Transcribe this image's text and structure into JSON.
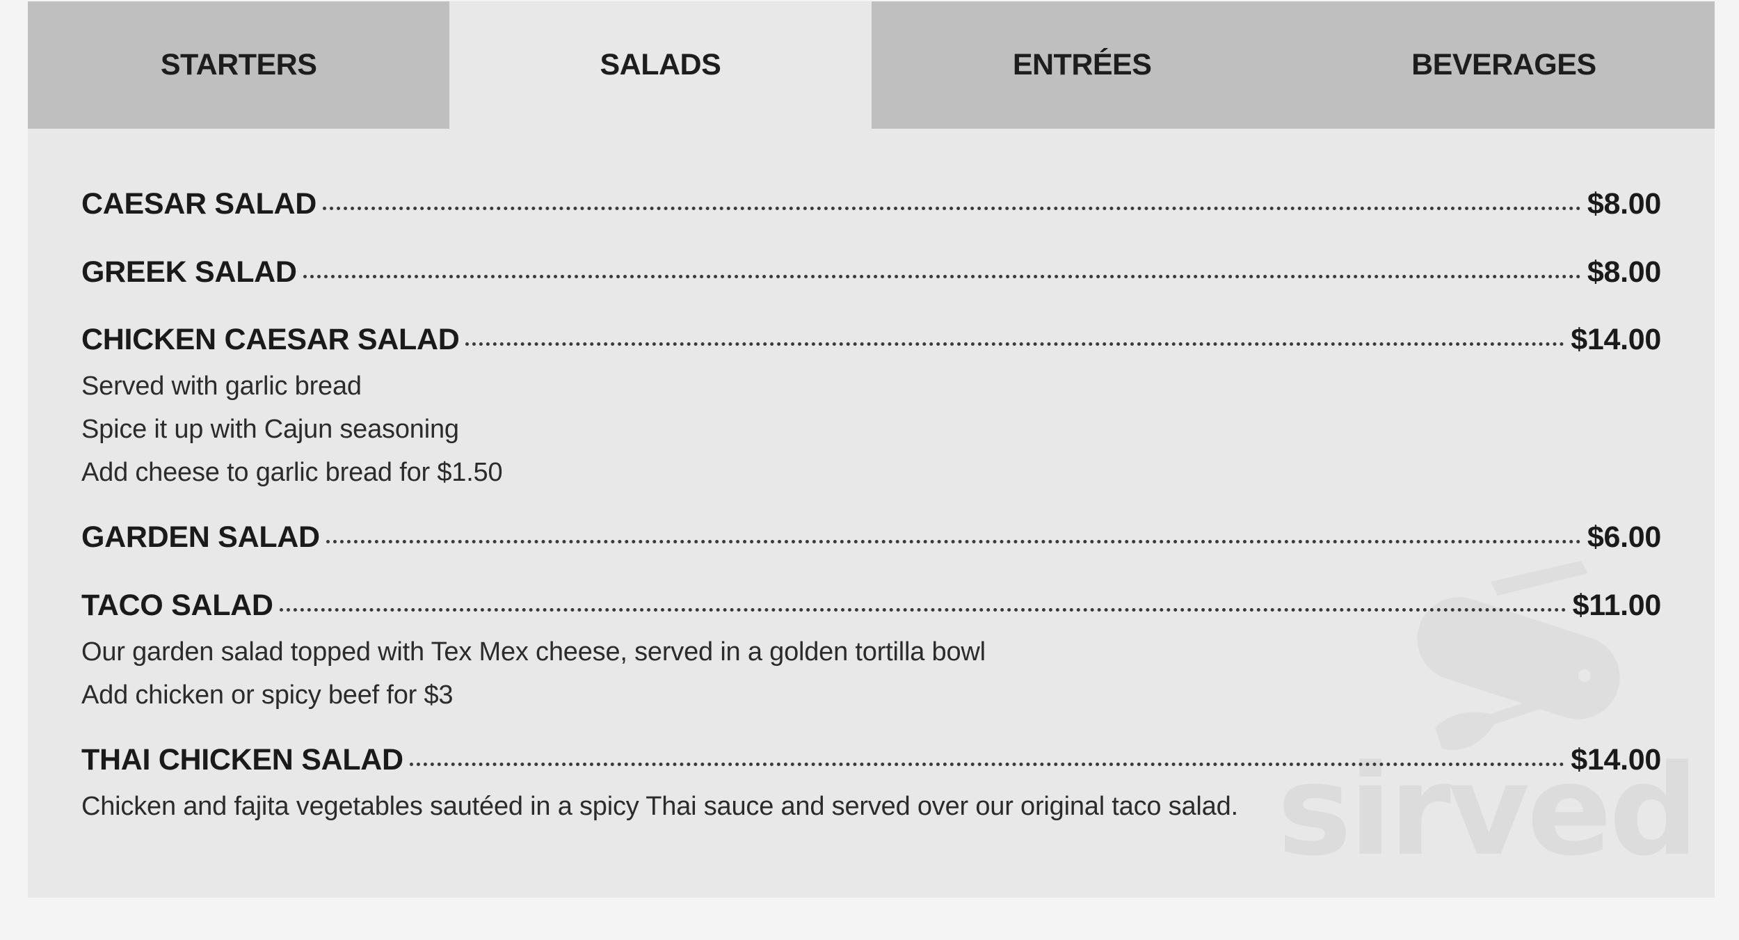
{
  "tabs": [
    {
      "label": "STARTERS"
    },
    {
      "label": "SALADS"
    },
    {
      "label": "ENTRÉES"
    },
    {
      "label": "BEVERAGES"
    }
  ],
  "active_tab": "SALADS",
  "items": [
    {
      "name": "CAESAR SALAD",
      "price": "$8.00",
      "desc": []
    },
    {
      "name": "GREEK SALAD",
      "price": "$8.00",
      "desc": []
    },
    {
      "name": "CHICKEN CAESAR SALAD",
      "price": "$14.00",
      "desc": [
        "Served with garlic bread",
        "Spice it up with Cajun seasoning",
        "Add cheese to garlic bread for $1.50"
      ]
    },
    {
      "name": "GARDEN SALAD",
      "price": "$6.00",
      "desc": []
    },
    {
      "name": "TACO SALAD",
      "price": "$11.00",
      "desc": [
        "Our garden salad topped with Tex Mex cheese, served in a golden tortilla bowl",
        "Add chicken or spicy beef for $3"
      ]
    },
    {
      "name": "THAI CHICKEN SALAD",
      "price": "$14.00",
      "desc": [
        "Chicken and fajita vegetables sautéed in a spicy Thai sauce and served over our original taco salad."
      ]
    }
  ],
  "watermark": {
    "text": "sirved",
    "icon": "knife-fork-spoon-icon"
  },
  "colors": {
    "page_bg": "#f4f4f4",
    "panel_bg": "#e8e8e8",
    "tab_bg": "#bfbfbf",
    "text": "#1a1a1a"
  }
}
